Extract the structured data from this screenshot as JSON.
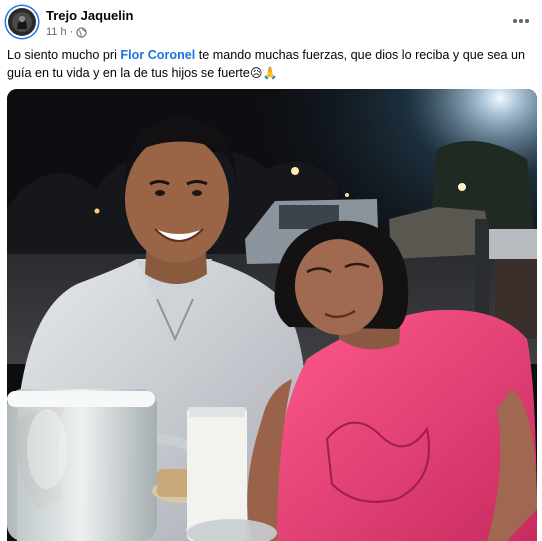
{
  "post": {
    "author": "Trejo Jaquelin",
    "time": "11 h",
    "separator": "·",
    "privacy_icon": "globe-icon",
    "more_icon": "more-horizontal-icon",
    "text_before": "Lo siento mucho pri ",
    "mention": "Flor Coronel",
    "text_after": " te mando muchas fuerzas, que dios lo reciba y que sea un guía en tu vida y en la de tus hijos se fuerte",
    "emojis": "😥🙏"
  },
  "photo": {
    "description_icon": "photo"
  },
  "colors": {
    "accent": "#1b74e4",
    "secondary_text": "#65676b",
    "primary_text": "#050505"
  }
}
